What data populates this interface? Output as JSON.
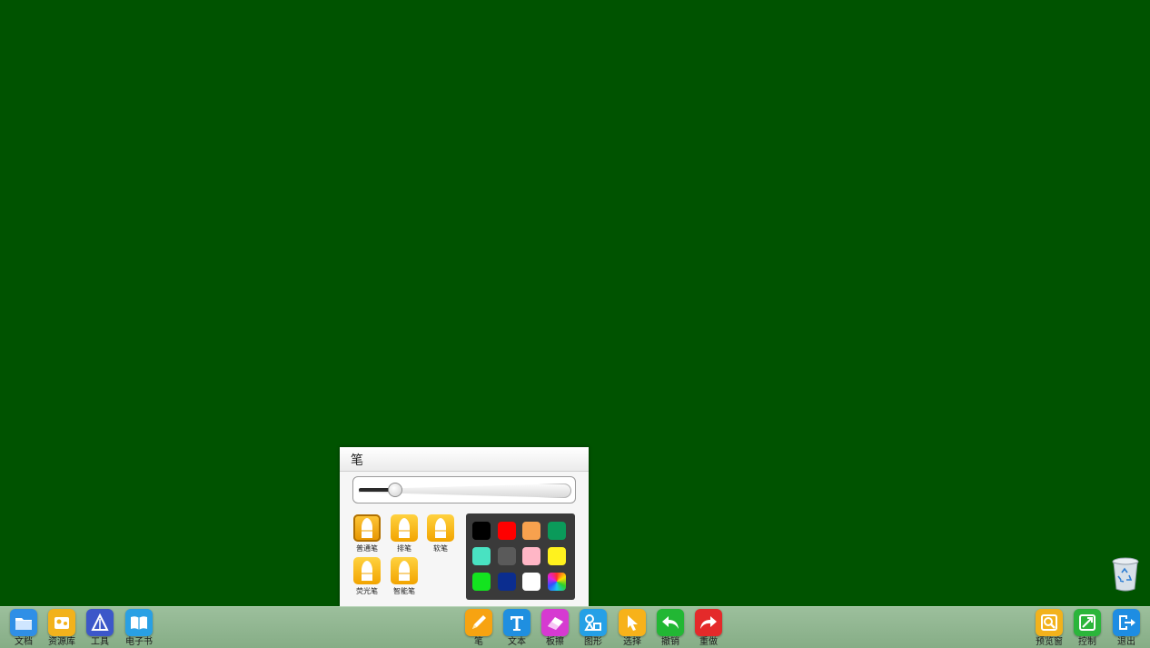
{
  "pen_panel": {
    "title": "笔",
    "thickness_fraction": 0.17,
    "pen_types": [
      {
        "label": "普通笔",
        "icon": "pen-normal-icon",
        "selected": true
      },
      {
        "label": "排笔",
        "icon": "pen-brush-icon",
        "selected": false
      },
      {
        "label": "软笔",
        "icon": "pen-soft-icon",
        "selected": false
      },
      {
        "label": "荧光笔",
        "icon": "pen-highlighter-icon",
        "selected": false
      },
      {
        "label": "智能笔",
        "icon": "pen-smart-icon",
        "selected": false
      }
    ],
    "colors": [
      "#000000",
      "#ff0000",
      "#f7a14e",
      "#0a9a5a",
      "#49e2c2",
      "#5a5a5a",
      "#ffb6c6",
      "#fff21e",
      "#13e31f",
      "#0b2d8f",
      "#ffffff",
      "rainbow"
    ]
  },
  "taskbar": {
    "left": [
      {
        "label": "文档",
        "icon": "folder-icon",
        "color": "#2f8fe6"
      },
      {
        "label": "资源库",
        "icon": "resource-icon",
        "color": "#f2b21c"
      },
      {
        "label": "工具",
        "icon": "tools-icon",
        "color": "#3c57c9"
      },
      {
        "label": "电子书",
        "icon": "ebook-icon",
        "color": "#29a0e4"
      }
    ],
    "center": [
      {
        "label": "笔",
        "icon": "pen-icon",
        "color": "#f7a311"
      },
      {
        "label": "文本",
        "icon": "text-icon",
        "color": "#1f8fe0"
      },
      {
        "label": "板擦",
        "icon": "eraser-icon",
        "color": "#d63ad1"
      },
      {
        "label": "图形",
        "icon": "shapes-icon",
        "color": "#25a0e6"
      },
      {
        "label": "选择",
        "icon": "select-icon",
        "color": "#f7b21a"
      },
      {
        "label": "撤销",
        "icon": "undo-icon",
        "color": "#22b734"
      },
      {
        "label": "重做",
        "icon": "redo-icon",
        "color": "#e42a2a"
      }
    ],
    "right": [
      {
        "label": "预览窗",
        "icon": "preview-icon",
        "color": "#f2b21c"
      },
      {
        "label": "控制",
        "icon": "control-icon",
        "color": "#2bb53b"
      },
      {
        "label": "退出",
        "icon": "exit-icon",
        "color": "#1e8de2"
      }
    ]
  },
  "trash": {
    "icon": "recycle-bin-icon"
  }
}
